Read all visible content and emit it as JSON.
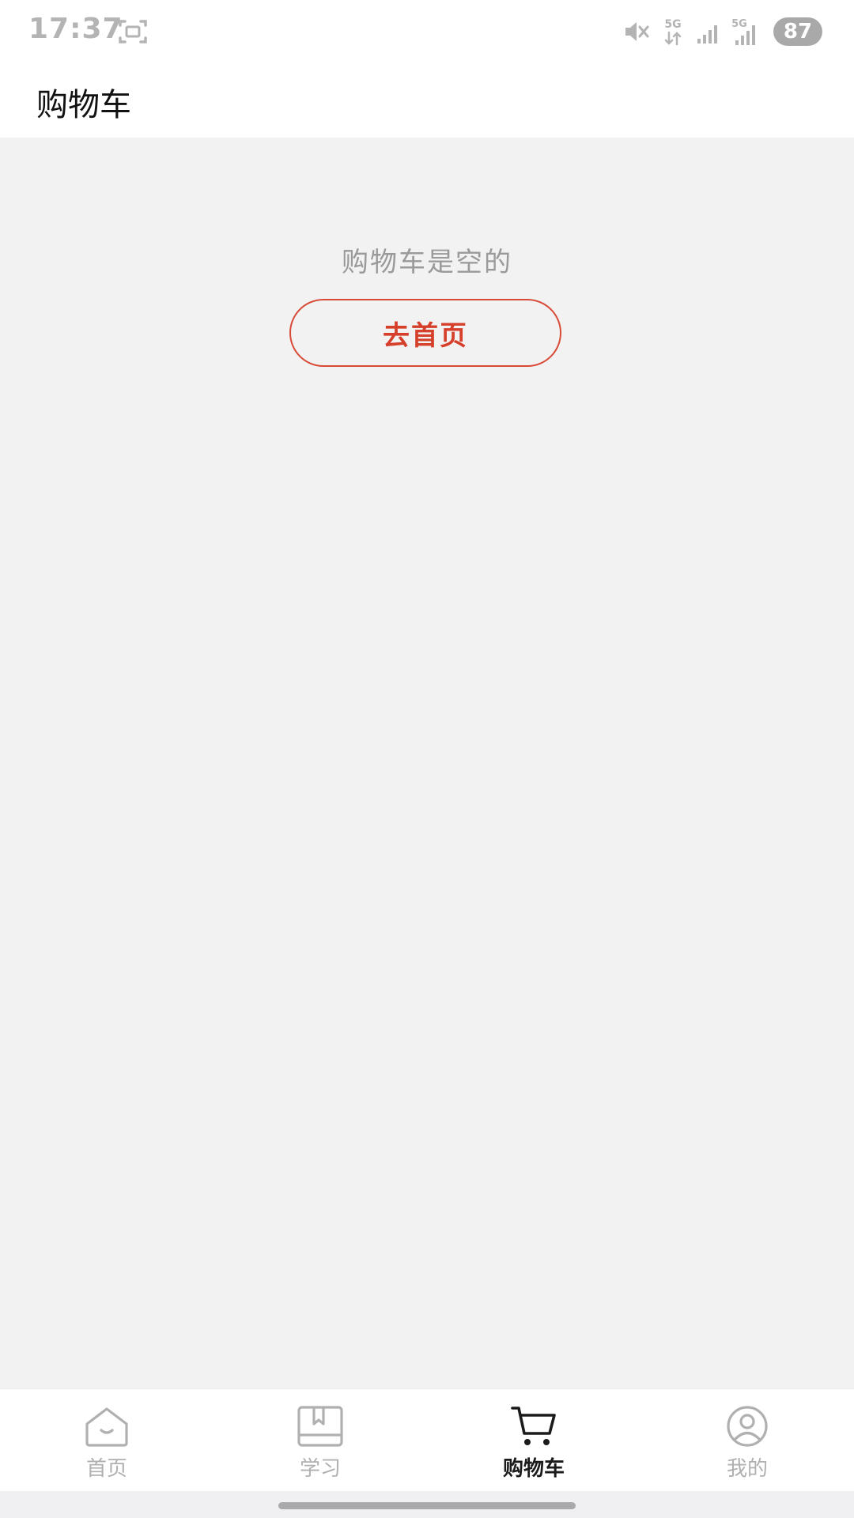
{
  "status_bar": {
    "time": "17:37",
    "network_1": "5G",
    "network_2": "5G",
    "battery": "87",
    "icons": [
      "screenshot-icon",
      "mute-icon",
      "data-arrows-icon",
      "signal-icon",
      "signal-icon"
    ]
  },
  "header": {
    "title": "购物车"
  },
  "empty_state": {
    "message": "购物车是空的",
    "button_label": "去首页"
  },
  "bottom_nav": {
    "items": [
      {
        "label": "首页",
        "icon": "home-icon",
        "active": false
      },
      {
        "label": "学习",
        "icon": "book-icon",
        "active": false
      },
      {
        "label": "购物车",
        "icon": "cart-icon",
        "active": true
      },
      {
        "label": "我的",
        "icon": "profile-icon",
        "active": false
      }
    ]
  },
  "colors": {
    "accent": "#d6402b",
    "background": "#f3f2f3",
    "inactive": "#b0b0b0",
    "active": "#1b1b1b"
  }
}
